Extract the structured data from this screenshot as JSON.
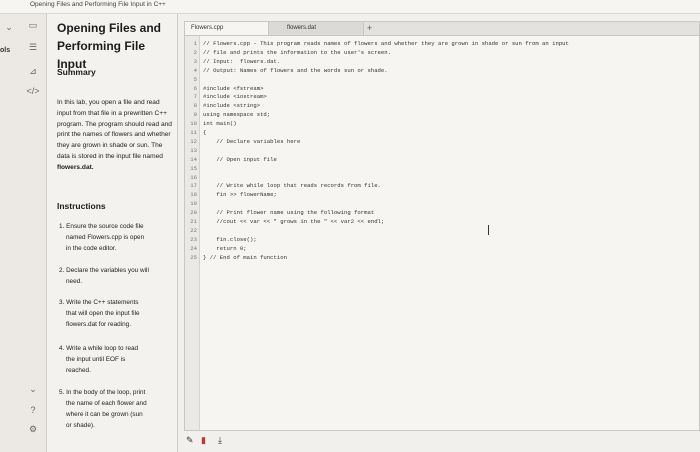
{
  "page": {
    "breadcrumb": "Opening Files and Performing File Input in C++"
  },
  "rail": {
    "label": "ols",
    "icons": [
      "chevron-down-icon",
      "book-icon",
      "list-icon",
      "chart-icon",
      "code-icon",
      "chevron-down-icon",
      "help-icon",
      "settings-icon"
    ]
  },
  "lesson": {
    "title": "Opening Files and Performing File Input",
    "summary_heading": "Summary",
    "summary_text": "In this lab, you open a file and read input from that file in a prewritten C++ program. The program should read and print the names of flowers and whether they are grown in shade or sun. The data is stored in the input file named",
    "summary_file": "flowers.dat.",
    "instructions_heading": "Instructions",
    "steps": [
      {
        "n": "1.",
        "lines": [
          "Ensure the source code file",
          "named Flowers.cpp is open",
          "in the code editor."
        ]
      },
      {
        "n": "2.",
        "lines": [
          "Declare the variables you will",
          "need."
        ]
      },
      {
        "n": "3.",
        "lines": [
          "Write the C++ statements",
          "that will open the input file",
          "flowers.dat for reading."
        ]
      },
      {
        "n": "4.",
        "lines": [
          "Write a while loop to read",
          "the input until EOF is",
          "reached."
        ]
      },
      {
        "n": "5.",
        "lines": [
          "In the body of the loop, print",
          "the name of each flower and",
          "where it can be grown (sun",
          "or shade)."
        ]
      }
    ]
  },
  "editor": {
    "tabs": [
      "Flowers.cpp",
      "flowers.dat"
    ],
    "new_tab": "+",
    "lines": [
      "// Flowers.cpp - This program reads names of flowers and whether they are grown in shade or sun from an input",
      "// file and prints the information to the user's screen.",
      "// Input:  flowers.dat.",
      "// Output: Names of flowers and the words sun or shade.",
      "",
      "#include <fstream>",
      "#include <iostream>",
      "#include <string>",
      "using namespace std;",
      "int main()",
      "{",
      "    // Declare variables here",
      "",
      "    // Open input file",
      "",
      "",
      "    // Write while loop that reads records from file.",
      "    fin >> flowerName;",
      "",
      "    // Print flower name using the following format",
      "    //cout << var << \" grows in the \" << var2 << endl;",
      "",
      "    fin.close();",
      "    return 0;",
      "} // End of main function"
    ]
  },
  "toolbar": {
    "tools": [
      "pencil-icon",
      "marker-icon",
      "download-icon"
    ]
  }
}
